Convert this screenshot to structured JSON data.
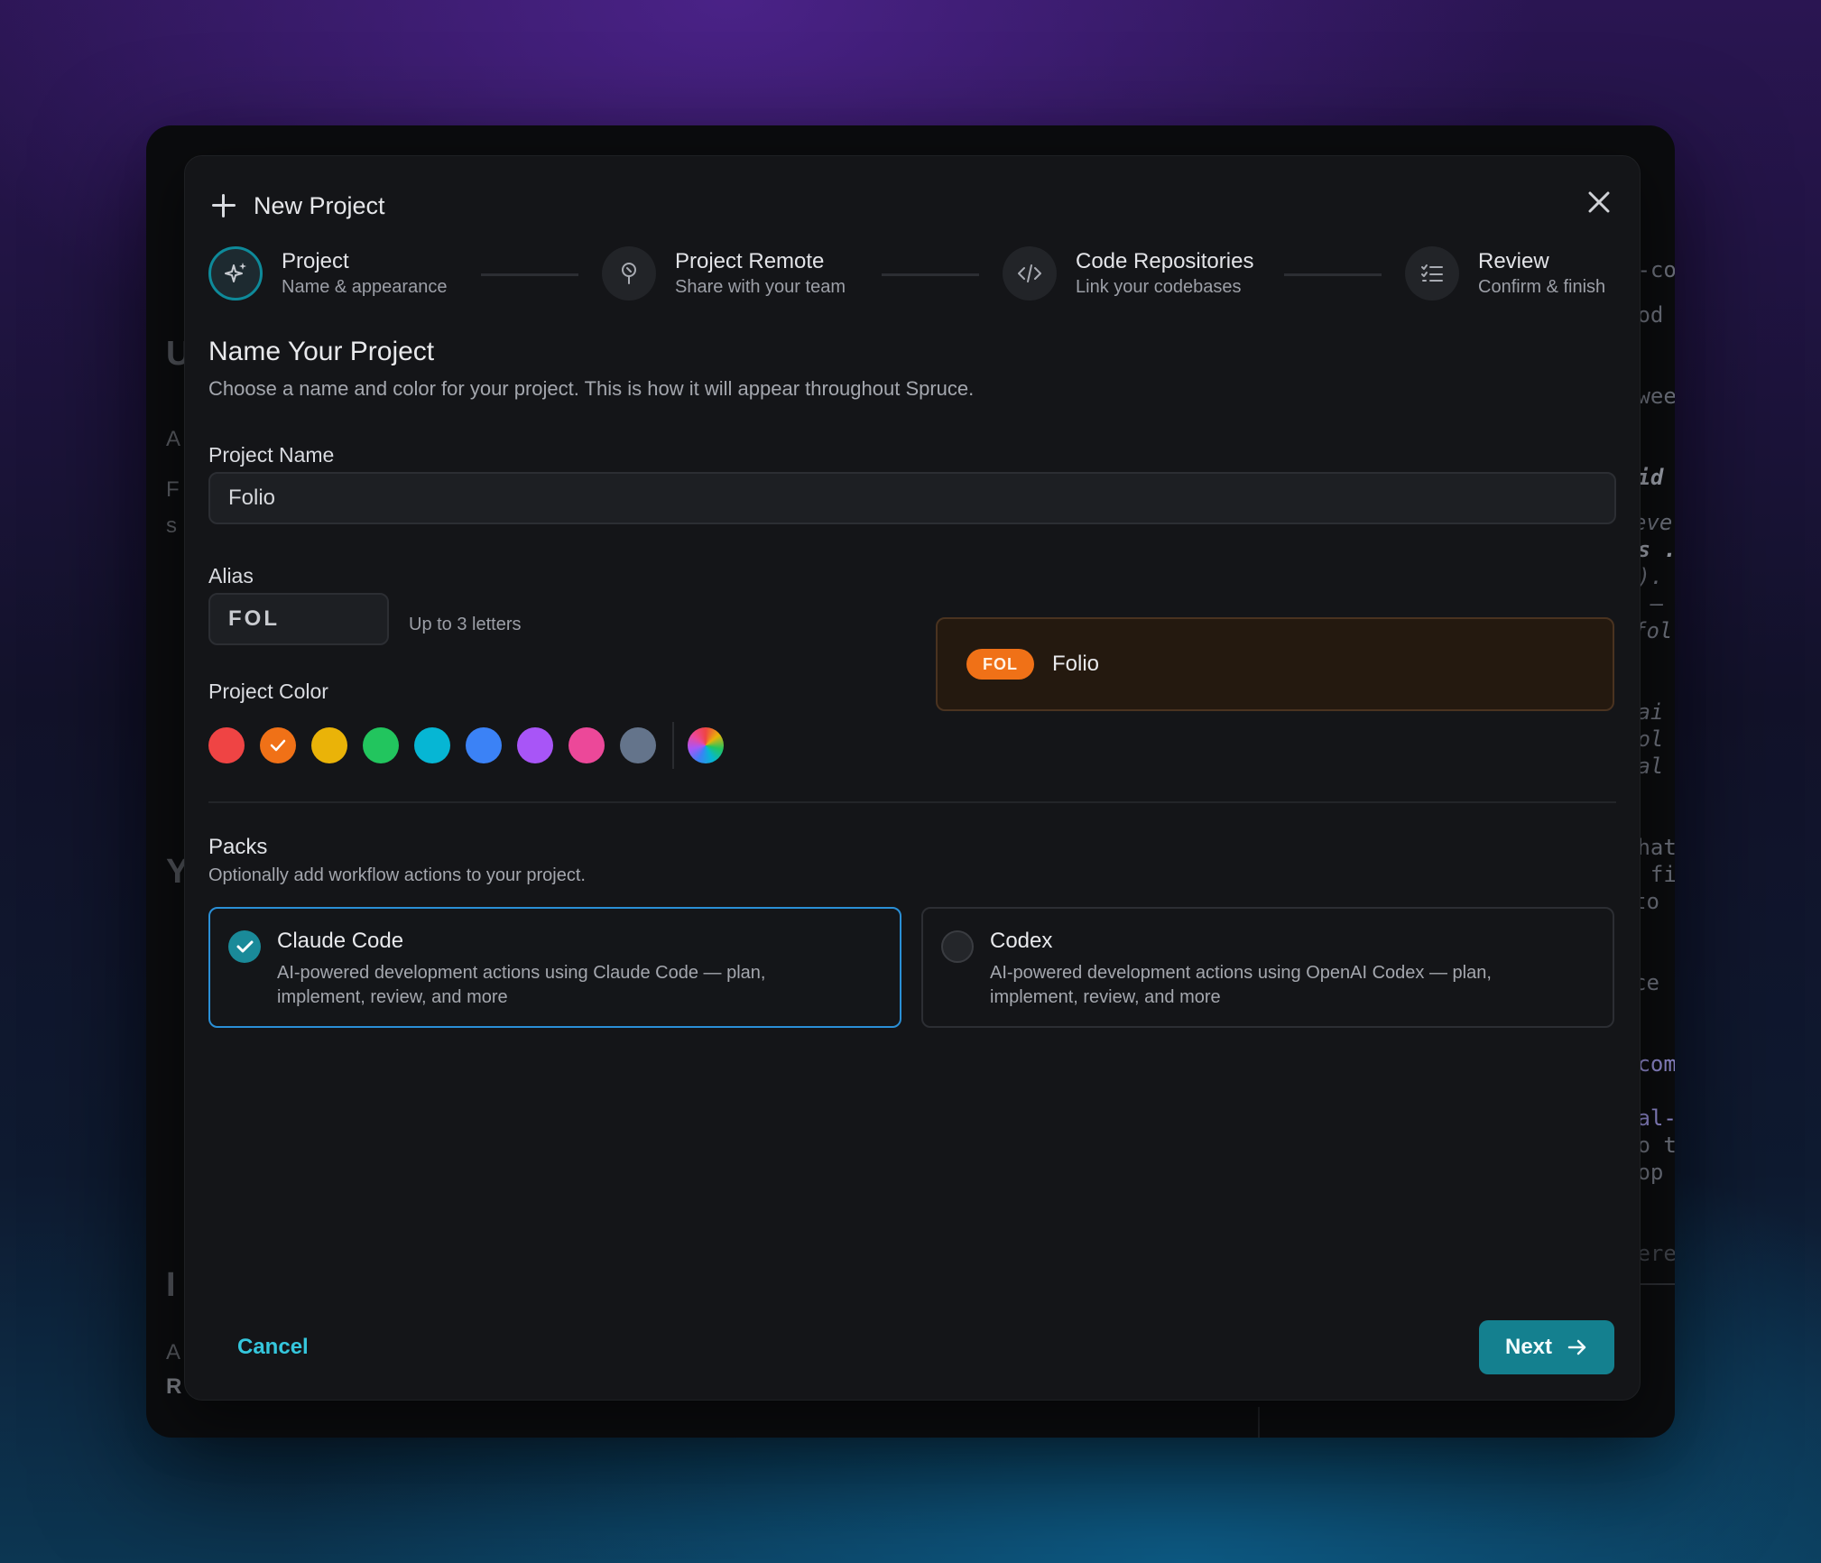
{
  "modal": {
    "title": "New Project"
  },
  "stepper": [
    {
      "label": "Project",
      "sub": "Name & appearance",
      "icon": "sparkles-icon",
      "active": true
    },
    {
      "label": "Project Remote",
      "sub": "Share with your team",
      "icon": "pin-icon",
      "active": false
    },
    {
      "label": "Code Repositories",
      "sub": "Link your codebases",
      "icon": "code-icon",
      "active": false
    },
    {
      "label": "Review",
      "sub": "Confirm & finish",
      "icon": "checklist-icon",
      "active": false
    }
  ],
  "form": {
    "heading": "Name Your Project",
    "subheading": "Choose a name and color for your project. This is how it will appear throughout Spruce.",
    "project_name_label": "Project Name",
    "project_name_value": "Folio",
    "alias_label": "Alias",
    "alias_value": "FOL",
    "alias_hint": "Up to 3 letters",
    "color_label": "Project Color",
    "colors": [
      "#ef4444",
      "#f07117",
      "#eab308",
      "#22c55e",
      "#06b6d4",
      "#3b82f6",
      "#a855f7",
      "#ec4899",
      "#64748b"
    ],
    "selected_color": "#f07117"
  },
  "preview": {
    "badge": "FOL",
    "name": "Folio"
  },
  "packs": {
    "title": "Packs",
    "subtitle": "Optionally add workflow actions to your project.",
    "items": [
      {
        "name": "Claude Code",
        "description": "AI-powered development actions using Claude Code — plan, implement, review, and more",
        "checked": true
      },
      {
        "name": "Codex",
        "description": "AI-powered development actions using OpenAI Codex — plan, implement, review, and more",
        "checked": false
      }
    ]
  },
  "footer": {
    "cancel_label": "Cancel",
    "next_label": "Next"
  },
  "background": {
    "code_fragments": [
      "e-co",
      "cod",
      "twee",
      "wid",
      "eve",
      "ls .",
      "e).",
      "e —",
      "fol",
      "vai",
      "ool",
      "bal",
      "what",
      "s fi",
      "to",
      "ce",
      "-com",
      "bal-",
      "to t",
      "top",
      "fere"
    ],
    "left_fragments": [
      "A",
      "F",
      "s",
      "Y",
      "I",
      "A",
      "R"
    ]
  },
  "theme": {
    "accent": "#14808f",
    "link": "#35c7dd",
    "selected_border": "#2a8fd6"
  }
}
